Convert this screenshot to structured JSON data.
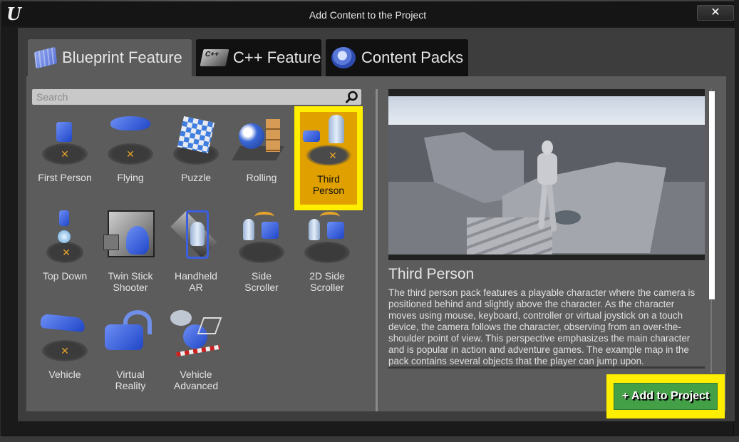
{
  "window": {
    "title": "Add Content to the Project",
    "logo": "U",
    "close_icon": "✕"
  },
  "tabs": [
    {
      "label": "Blueprint Feature",
      "icon": "blueprint-icon",
      "active": true
    },
    {
      "label": "C++ Feature",
      "icon": "cpp-icon",
      "icon_text": "C++",
      "active": false
    },
    {
      "label": "Content Packs",
      "icon": "content-pack-icon",
      "active": false
    }
  ],
  "search": {
    "placeholder": "Search",
    "value": ""
  },
  "templates": [
    {
      "label": "First Person",
      "selected": false
    },
    {
      "label": "Flying",
      "selected": false
    },
    {
      "label": "Puzzle",
      "selected": false
    },
    {
      "label": "Rolling",
      "selected": false
    },
    {
      "label": "Third\nPerson",
      "selected": true
    },
    {
      "label": "Top Down",
      "selected": false
    },
    {
      "label": "Twin Stick\nShooter",
      "selected": false
    },
    {
      "label": "Handheld\nAR",
      "selected": false
    },
    {
      "label": "Side\nScroller",
      "selected": false
    },
    {
      "label": "2D Side\nScroller",
      "selected": false
    },
    {
      "label": "Vehicle",
      "selected": false
    },
    {
      "label": "Virtual\nReality",
      "selected": false
    },
    {
      "label": "Vehicle\nAdvanced",
      "selected": false
    }
  ],
  "details": {
    "title": "Third Person",
    "description": "The third person pack features a playable character where the camera is positioned behind and slightly above the character. As the character moves using mouse, keyboard, controller or virtual joystick on a touch device, the camera follows the character, observing from an over-the-shoulder point of view. This perspective emphasizes the main character and is popular in action and adventure games. The example map in the pack contains several objects that the player can jump upon."
  },
  "actions": {
    "add_label": "Add to Project",
    "add_icon": "+"
  },
  "colors": {
    "highlight": "#ffee00",
    "selected_tile": "#e0a000",
    "add_button": "#43a047"
  }
}
